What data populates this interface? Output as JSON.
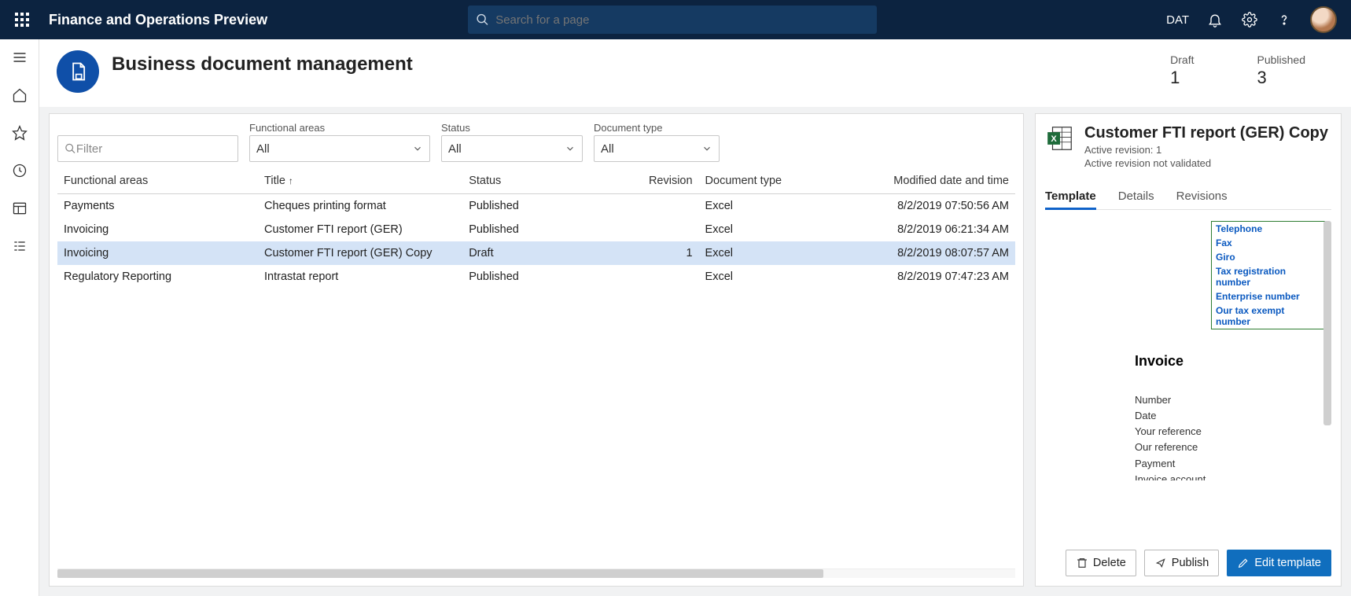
{
  "top": {
    "app_title": "Finance and Operations Preview",
    "search_placeholder": "Search for a page",
    "company": "DAT"
  },
  "page": {
    "title": "Business document management",
    "stats": [
      {
        "label": "Draft",
        "value": "1"
      },
      {
        "label": "Published",
        "value": "3"
      }
    ]
  },
  "filters": {
    "filter_placeholder": "Filter",
    "functional_areas": {
      "label": "Functional areas",
      "value": "All"
    },
    "status": {
      "label": "Status",
      "value": "All"
    },
    "document_type": {
      "label": "Document type",
      "value": "All"
    }
  },
  "columns": {
    "functional_areas": "Functional areas",
    "title": "Title",
    "status": "Status",
    "revision": "Revision",
    "document_type": "Document type",
    "modified": "Modified date and time"
  },
  "rows": [
    {
      "fa": "Payments",
      "title": "Cheques printing format",
      "status": "Published",
      "rev": "",
      "doc": "Excel",
      "mod": "8/2/2019 07:50:56 AM",
      "sel": false
    },
    {
      "fa": "Invoicing",
      "title": "Customer FTI report (GER)",
      "status": "Published",
      "rev": "",
      "doc": "Excel",
      "mod": "8/2/2019 06:21:34 AM",
      "sel": false
    },
    {
      "fa": "Invoicing",
      "title": "Customer FTI report (GER) Copy",
      "status": "Draft",
      "rev": "1",
      "doc": "Excel",
      "mod": "8/2/2019 08:07:57 AM",
      "sel": true
    },
    {
      "fa": "Regulatory Reporting",
      "title": "Intrastat report",
      "status": "Published",
      "rev": "",
      "doc": "Excel",
      "mod": "8/2/2019 07:47:23 AM",
      "sel": false
    }
  ],
  "side": {
    "title": "Customer FTI report (GER) Copy",
    "sub1": "Active revision: 1",
    "sub2": "Active revision not validated",
    "tabs": {
      "template": "Template",
      "details": "Details",
      "revisions": "Revisions"
    },
    "preview": {
      "header_fields": [
        "Telephone",
        "Fax",
        "Giro",
        "Tax registration number",
        "Enterprise number",
        "Our tax exempt number"
      ],
      "invoice_label": "Invoice",
      "invoice_fields": [
        "Number",
        "Date",
        "Your reference",
        "Our reference",
        "Payment",
        "Invoice account"
      ]
    },
    "actions": {
      "delete": "Delete",
      "publish": "Publish",
      "edit": "Edit template"
    }
  }
}
